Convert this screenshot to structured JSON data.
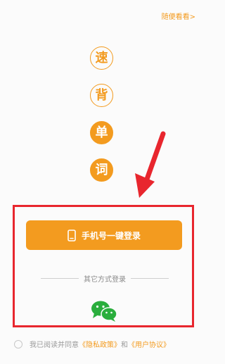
{
  "header": {
    "skip_label": "随便看看>"
  },
  "logo": {
    "chars": [
      "速",
      "背",
      "单",
      "词"
    ]
  },
  "login": {
    "phone_button_label": "手机号一键登录",
    "other_methods_label": "其它方式登录"
  },
  "agreement": {
    "prefix": "我已阅读并同意",
    "privacy_link": "《隐私政策》",
    "and": "和",
    "user_link": "《用户协议》"
  },
  "colors": {
    "accent": "#f39b1f",
    "wechat": "#2aae3d",
    "annotation": "#e8262e"
  }
}
